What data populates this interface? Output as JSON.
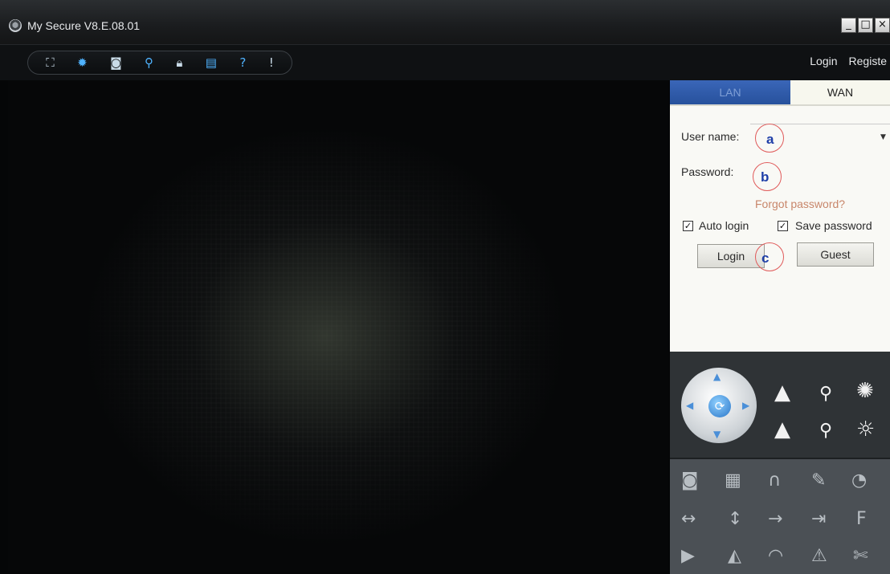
{
  "window": {
    "title": "My Secure  V8.E.08.01",
    "controls": [
      "_",
      "□",
      "×"
    ]
  },
  "toolbar": {
    "icons": [
      "fullscreen-icon",
      "settings-icon",
      "snapshot-icon",
      "search-icon",
      "lock-icon",
      "calculator-icon",
      "help-icon",
      "alert-icon"
    ],
    "login_link": "Login",
    "register_link": "Registe"
  },
  "tabs": {
    "lan": "LAN",
    "wan": "WAN"
  },
  "login": {
    "username_label": "User name:",
    "username_value": "",
    "password_label": "Password:",
    "password_value": "",
    "forgot": "Forgot password?",
    "auto_login": "Auto login",
    "save_password": "Save password",
    "login_button": "Login",
    "guest_button": "Guest"
  },
  "annotations": {
    "a": "a",
    "b": "b",
    "c": "c"
  },
  "colors": {
    "lan_tab": "#3a66b8",
    "annotation_circle": "#e05a5a",
    "annotation_letter": "#1f3fa8",
    "forgot_link": "#c8866a"
  }
}
